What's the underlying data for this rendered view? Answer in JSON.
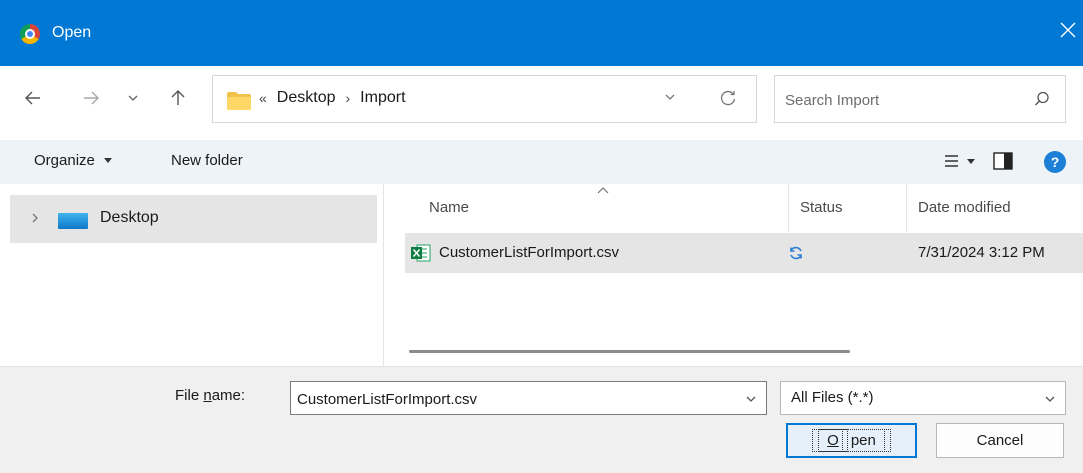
{
  "window": {
    "title": "Open",
    "icon": "chrome-icon"
  },
  "navigation": {
    "breadcrumb_prefix": "«",
    "breadcrumbs": [
      "Desktop",
      "Import"
    ],
    "breadcrumb_separator": "›"
  },
  "search": {
    "placeholder": "Search Import"
  },
  "toolbar": {
    "organize_label": "Organize",
    "new_folder_label": "New folder"
  },
  "nav_pane": {
    "items": [
      {
        "label": "Desktop",
        "icon": "desktop-icon"
      }
    ]
  },
  "file_list": {
    "columns": [
      "Name",
      "Status",
      "Date modified"
    ],
    "rows": [
      {
        "name": "CustomerListForImport.csv",
        "status_icon": "sync-icon",
        "date_modified": "7/31/2024 3:12 PM"
      }
    ]
  },
  "bottom": {
    "file_name_label_pre": "File ",
    "file_name_label_u": "n",
    "file_name_label_post": "ame:",
    "file_name_value": "CustomerListForImport.csv",
    "file_type_value": "All Files (*.*)",
    "open_u": "O",
    "open_rest": "pen",
    "cancel_label": "Cancel"
  },
  "colors": {
    "titlebar": "#0078d4",
    "toolbar_bg": "#eef3f8",
    "selection": "#e5e5e5",
    "help_icon": "#1d7fd6"
  }
}
